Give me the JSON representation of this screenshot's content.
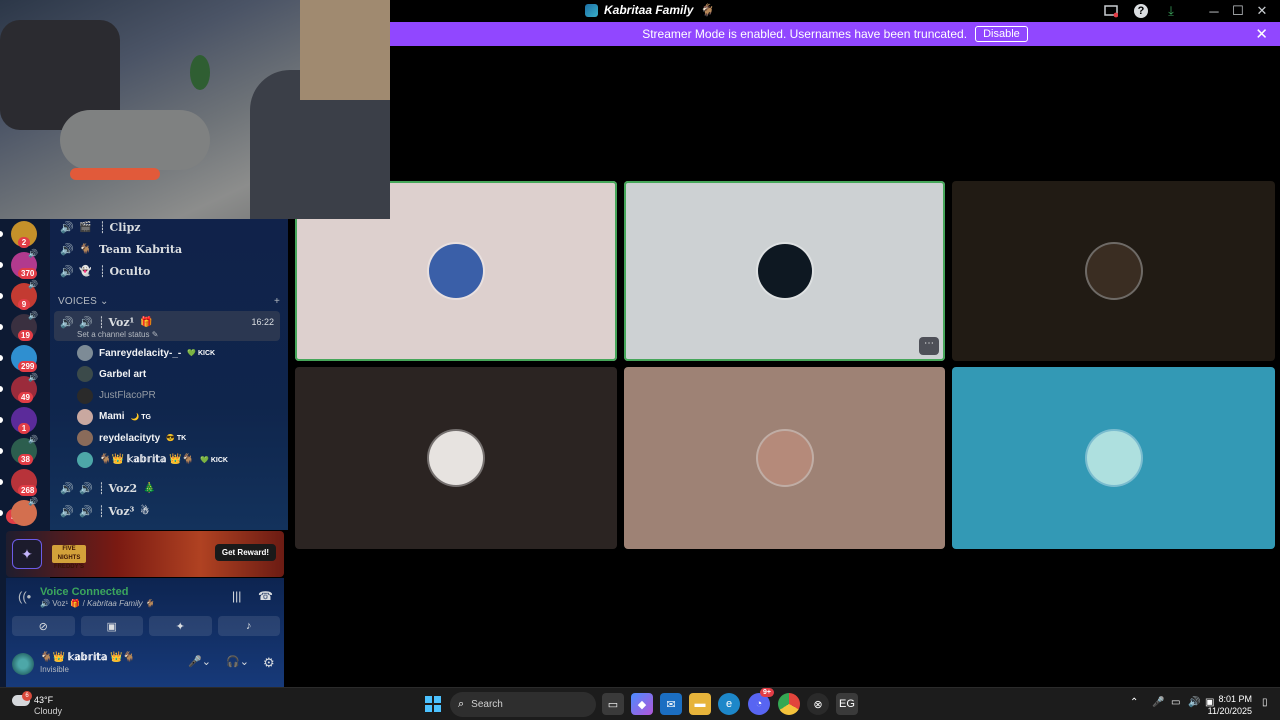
{
  "window": {
    "title": "Kabritaa Family",
    "title_emoji": "🐐",
    "icons": {
      "monitor": "screen-icon",
      "help": "?",
      "download": "⤓",
      "minimize": "─",
      "maximize": "☐",
      "close": "✕"
    }
  },
  "banner": {
    "message": "Streamer Mode is enabled. Usernames have been truncated.",
    "button": "Disable",
    "close": "✕"
  },
  "servers": [
    {
      "badge": "2",
      "color": "#c5912a"
    },
    {
      "badge": "370",
      "color": "#b13a8e"
    },
    {
      "badge": "9",
      "color": "#c33b32"
    },
    {
      "badge": "19",
      "color": "#3a3040"
    },
    {
      "badge": "299",
      "color": "#2f8fd0"
    },
    {
      "badge": "49",
      "color": "#9b2b3b"
    },
    {
      "badge": "1",
      "color": "#5b2b9a"
    },
    {
      "badge": "38",
      "color": "#2c5e4e"
    },
    {
      "badge": "268",
      "color": "#b8333a"
    },
    {
      "badge": "",
      "color": "#d36f4f"
    }
  ],
  "servers_new_badge": "NEW",
  "sidebar": {
    "text_channels": [
      {
        "emoji": "🎬",
        "name": "┊ Clipz"
      },
      {
        "emoji": "🐐",
        "name": "Team Kabrita"
      },
      {
        "emoji": "👻",
        "name": "┊ Oculto"
      }
    ],
    "voice_section": "VOICES",
    "voice_section_add": "+",
    "active_channel": {
      "name": "┊ Voz¹",
      "emoji": "🎁",
      "time": "16:22",
      "status": "Set a channel status"
    },
    "members": [
      {
        "name": "Fanreydelacity-_-",
        "tag": "KICK",
        "tag_mark": "💚",
        "dim": false,
        "color": "#7d8b96"
      },
      {
        "name": "Garbel art",
        "tag": "",
        "tag_mark": "",
        "dim": false,
        "color": "#3b4a4a"
      },
      {
        "name": "JustFlacoPR",
        "tag": "",
        "tag_mark": "",
        "dim": true,
        "color": "#2a2a2a"
      },
      {
        "name": "Mami",
        "tag": "TG",
        "tag_mark": "🌙",
        "dim": false,
        "color": "#c9a8a0"
      },
      {
        "name": "reydelacityty",
        "tag": "TK",
        "tag_mark": "😎",
        "dim": false,
        "color": "#8a6b5a"
      },
      {
        "name": "🐐👑 𝕜𝕒𝕓𝕣𝕚𝕥𝕒 👑🐐",
        "tag": "KICK",
        "tag_mark": "💚",
        "dim": false,
        "color": "#4da7a8"
      }
    ],
    "other_voice": [
      {
        "name": "┊ Voz2",
        "emoji": "🎄"
      },
      {
        "name": "┊ Voz³",
        "emoji": "☃"
      }
    ]
  },
  "promo": {
    "logo_text": "FIVE NIGHTS FREDDY'S",
    "button": "Get Reward!"
  },
  "voice_panel": {
    "status": "Voice Connected",
    "channel": "Voz¹ 🎁 / ",
    "server": "Kabritaa Family 🐐",
    "buttons": [
      "camera-off-icon",
      "screen-share-icon",
      "activities-icon",
      "soundboard-icon"
    ]
  },
  "user": {
    "name": "🐐👑 𝕜𝕒𝕓𝕣𝕚𝕥𝕒 👑🐐",
    "status": "Invisible"
  },
  "tiles": [
    {
      "bg": "#ddd0ce",
      "speaking": true,
      "avatar": "#3a5fa8",
      "more": false
    },
    {
      "bg": "#cdd1d3",
      "speaking": true,
      "avatar": "#0e1822",
      "more": true
    },
    {
      "bg": "#211b14",
      "speaking": false,
      "avatar": "#3a2d22",
      "more": false
    },
    {
      "bg": "#2b2422",
      "speaking": false,
      "avatar": "#e7e3e0",
      "more": false
    },
    {
      "bg": "#9e8275",
      "speaking": false,
      "avatar": "#b58a7a",
      "more": false
    },
    {
      "bg": "#3399b5",
      "speaking": false,
      "avatar": "#aee0df",
      "more": false
    }
  ],
  "tile_more_label": "⋯",
  "taskbar": {
    "weather_temp": "43°F",
    "weather_desc": "Cloudy",
    "weather_badge": "6",
    "search_label": "Search",
    "discord_badge": "9+",
    "time": "8:01 PM",
    "date": "11/20/2025"
  }
}
